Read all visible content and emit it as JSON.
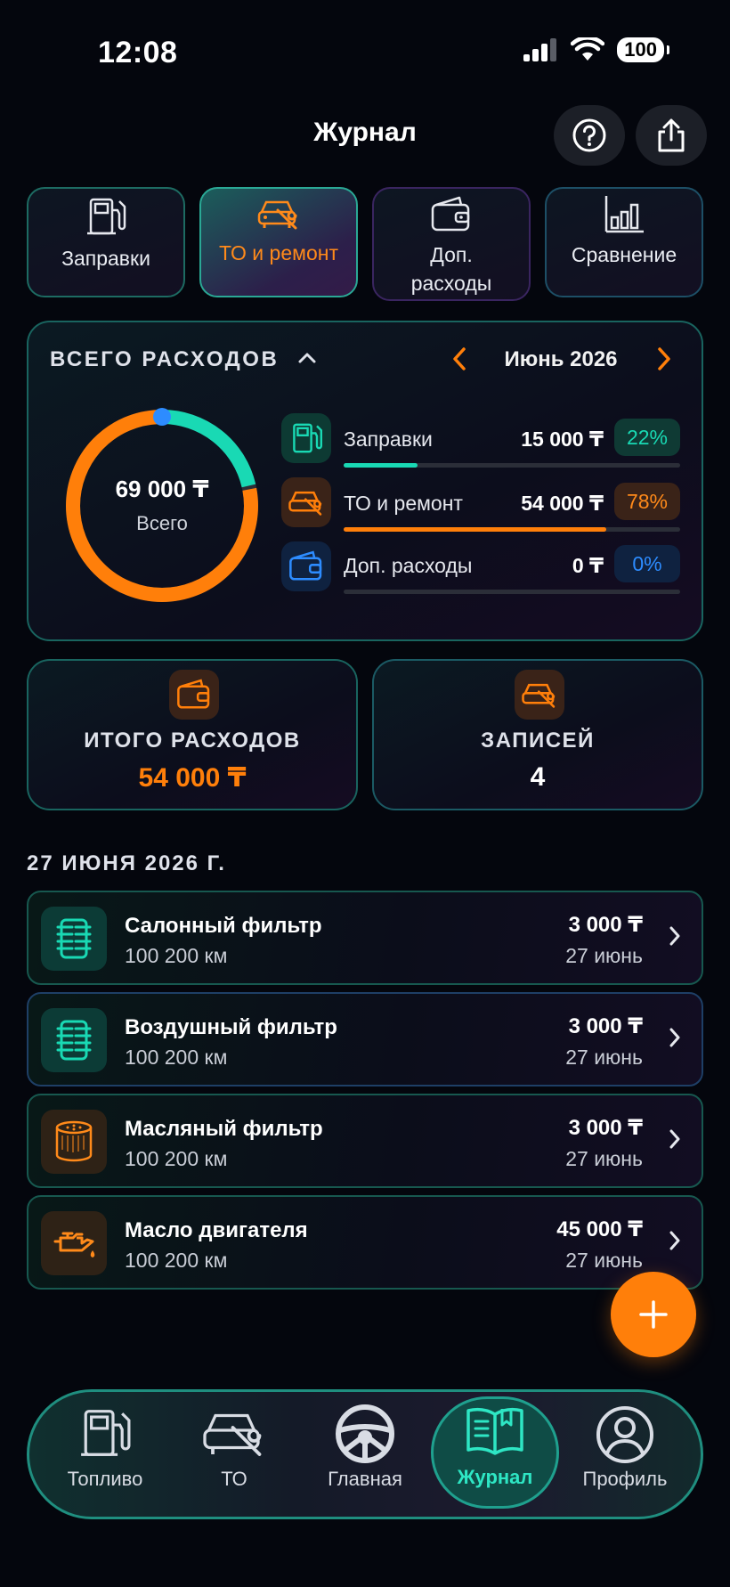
{
  "status_bar": {
    "time": "12:08",
    "battery": "100"
  },
  "header": {
    "title": "Журнал",
    "help_icon": "question-icon",
    "share_icon": "share-icon"
  },
  "categories": [
    {
      "label": "Заправки",
      "icon": "fuel-pump-icon",
      "active": false
    },
    {
      "label": "ТО и ремонт",
      "icon": "car-wrench-icon",
      "active": true
    },
    {
      "label": "Доп. расходы",
      "icon": "wallet-icon",
      "active": false
    },
    {
      "label": "Сравнение",
      "icon": "bar-chart-icon",
      "active": false
    }
  ],
  "summary": {
    "title": "ВСЕГО РАСХОДОВ",
    "month": "Июнь 2026",
    "total": "69 000 ₸",
    "total_label": "Всего",
    "breakdown": [
      {
        "name": "Заправки",
        "amount": "15 000 ₸",
        "percent": "22%",
        "fraction": 0.22,
        "color": "#19d9b4"
      },
      {
        "name": "ТО и ремонт",
        "amount": "54 000 ₸",
        "percent": "78%",
        "fraction": 0.78,
        "color": "#ff7f0a"
      },
      {
        "name": "Доп. расходы",
        "amount": "0 ₸",
        "percent": "0%",
        "fraction": 0.0,
        "color": "#2d8cff"
      }
    ]
  },
  "stats": {
    "total_label": "ИТОГО РАСХОДОВ",
    "total_value": "54 000 ₸",
    "records_label": "ЗАПИСЕЙ",
    "records_value": "4"
  },
  "date_group": "27 ИЮНЯ 2026 Г.",
  "entries": [
    {
      "title": "Салонный фильтр",
      "mileage": "100 200 км",
      "amount": "3 000 ₸",
      "date": "27 июнь",
      "icon": "cabin-filter-icon"
    },
    {
      "title": "Воздушный фильтр",
      "mileage": "100 200 км",
      "amount": "3 000 ₸",
      "date": "27 июнь",
      "icon": "air-filter-icon"
    },
    {
      "title": "Масляный фильтр",
      "mileage": "100 200 км",
      "amount": "3 000 ₸",
      "date": "27 июнь",
      "icon": "oil-filter-icon"
    },
    {
      "title": "Масло двигателя",
      "mileage": "100 200 км",
      "amount": "45 000 ₸",
      "date": "27 июнь",
      "icon": "oil-can-icon"
    }
  ],
  "nav": [
    {
      "label": "Топливо",
      "icon": "fuel-pump-icon"
    },
    {
      "label": "ТО",
      "icon": "car-wrench-icon"
    },
    {
      "label": "Главная",
      "icon": "steering-wheel-icon"
    },
    {
      "label": "Журнал",
      "icon": "book-icon",
      "active": true
    },
    {
      "label": "Профиль",
      "icon": "user-icon"
    }
  ],
  "colors": {
    "accent": "#ff7f0a",
    "teal": "#19d9b4",
    "blue": "#2d8cff",
    "background": "#04060d"
  }
}
